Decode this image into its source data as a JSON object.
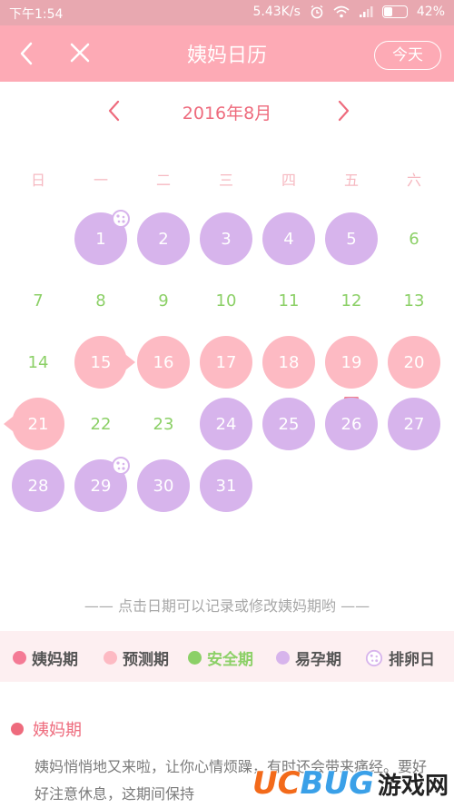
{
  "status_bar": {
    "time": "下午1:54",
    "network_speed": "5.43K/s",
    "battery": "42%",
    "battery_level": 0.42
  },
  "nav": {
    "title": "姨妈日历",
    "today_button": "今天"
  },
  "calendar": {
    "month_label": "2016年8月",
    "weekdays": [
      "日",
      "一",
      "二",
      "三",
      "四",
      "五",
      "六"
    ],
    "days": [
      {
        "label": "1",
        "type": "fertile",
        "ovulation": true
      },
      {
        "label": "2",
        "type": "fertile"
      },
      {
        "label": "3",
        "type": "fertile"
      },
      {
        "label": "4",
        "type": "fertile"
      },
      {
        "label": "5",
        "type": "fertile"
      },
      {
        "label": "6",
        "type": "safe"
      },
      {
        "label": "7",
        "type": "safe"
      },
      {
        "label": "8",
        "type": "safe"
      },
      {
        "label": "9",
        "type": "safe"
      },
      {
        "label": "10",
        "type": "safe"
      },
      {
        "label": "11",
        "type": "safe"
      },
      {
        "label": "12",
        "type": "safe"
      },
      {
        "label": "13",
        "type": "safe"
      },
      {
        "label": "14",
        "type": "safe"
      },
      {
        "label": "15",
        "type": "period",
        "period_start": true
      },
      {
        "label": "16",
        "type": "period"
      },
      {
        "label": "17",
        "type": "period"
      },
      {
        "label": "18",
        "type": "period"
      },
      {
        "label": "19",
        "type": "period",
        "today": true
      },
      {
        "label": "20",
        "type": "period"
      },
      {
        "label": "21",
        "type": "period",
        "period_end": true
      },
      {
        "label": "22",
        "type": "safe"
      },
      {
        "label": "23",
        "type": "safe"
      },
      {
        "label": "24",
        "type": "fertile"
      },
      {
        "label": "25",
        "type": "fertile"
      },
      {
        "label": "26",
        "type": "fertile"
      },
      {
        "label": "27",
        "type": "fertile"
      },
      {
        "label": "28",
        "type": "fertile"
      },
      {
        "label": "29",
        "type": "fertile",
        "ovulation": true
      },
      {
        "label": "30",
        "type": "fertile"
      },
      {
        "label": "31",
        "type": "fertile"
      }
    ]
  },
  "hint": "—— 点击日期可以记录或修改姨妈期哟 ——",
  "legend": [
    {
      "label": "姨妈期",
      "color": "#f47a95",
      "icon": "period-dot"
    },
    {
      "label": "预测期",
      "color": "#fdbac3",
      "icon": "predicted-dot"
    },
    {
      "label": "安全期",
      "color": "#8cd067",
      "icon": "safe-dot"
    },
    {
      "label": "易孕期",
      "color": "#d7b4ec",
      "icon": "fertile-dot"
    },
    {
      "label": "排卵日",
      "color": "#d7b4ec",
      "icon": "ovulation-icon"
    }
  ],
  "info": {
    "title": "姨妈期",
    "text": "姨妈悄悄地又来啦，让你心情烦躁，有时还会带来痛经。要好好注意休息，这期间保持"
  },
  "watermark": {
    "logo_main": "UC",
    "logo_accent": "BUG",
    "text": "游戏网"
  },
  "colors": {
    "nav": "#fdaab5",
    "status": "#e8a8b0",
    "accent": "#ee6b7d",
    "safe": "#8cd067",
    "period": "#fdbac3",
    "fertile": "#d7b4ec"
  }
}
